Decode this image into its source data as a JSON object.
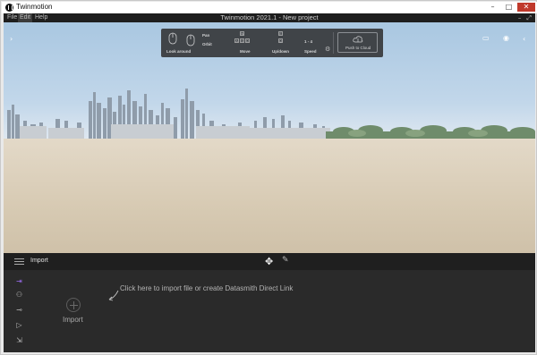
{
  "window": {
    "app_title": "Twinmotion",
    "controls": [
      "–",
      "□",
      "✕"
    ]
  },
  "menubar": {
    "items": [
      "File",
      "Edit",
      "Help"
    ],
    "project_title": "Twinmotion 2021.1 - New project",
    "mini_controls": [
      "–",
      "⤢"
    ]
  },
  "navigation": {
    "look_around": "Look around",
    "pan": "Pan",
    "orbit": "Orbit",
    "move": "Move",
    "up_down": "Up/down",
    "speed": "Speed",
    "speed_keys": "1 - 4",
    "push_to_cloud": "Push to Cloud"
  },
  "toolbar": {
    "tab_label": "Import"
  },
  "import_panel": {
    "button_label": "Import",
    "hint": "Click here to import file or create Datasmith Direct Link"
  },
  "icons": {
    "accent": "#9b6cf0"
  }
}
